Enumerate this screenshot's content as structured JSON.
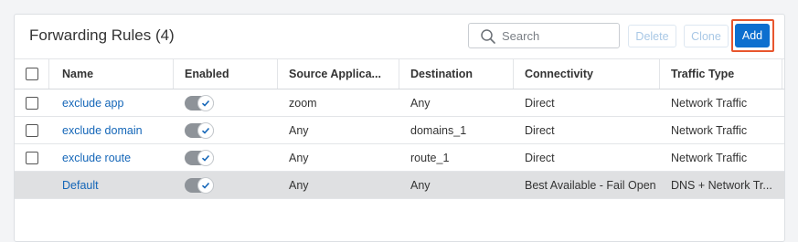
{
  "panel": {
    "title": "Forwarding Rules (4)",
    "search_placeholder": "Search",
    "buttons": {
      "delete": "Delete",
      "clone": "Clone",
      "add": "Add"
    }
  },
  "colors": {
    "accent": "#0d6fcf",
    "link": "#1466b8",
    "highlight": "#e8562e",
    "default_row": "#dfe0e2",
    "toggle_on": "#8e9399"
  },
  "table": {
    "headers": [
      "Name",
      "Enabled",
      "Source Applica...",
      "Destination",
      "Connectivity",
      "Traffic Type"
    ],
    "rows": [
      {
        "name": "exclude app",
        "enabled": true,
        "source": "zoom",
        "destination": "Any",
        "connectivity": "Direct",
        "traffic": "Network Traffic"
      },
      {
        "name": "exclude domain",
        "enabled": true,
        "source": "Any",
        "destination": "domains_1",
        "connectivity": "Direct",
        "traffic": "Network Traffic"
      },
      {
        "name": "exclude route",
        "enabled": true,
        "source": "Any",
        "destination": "route_1",
        "connectivity": "Direct",
        "traffic": "Network Traffic"
      },
      {
        "name": "Default",
        "enabled": true,
        "source": "Any",
        "destination": "Any",
        "connectivity": "Best Available - Fail Open",
        "traffic": "DNS + Network Tr..."
      }
    ]
  }
}
